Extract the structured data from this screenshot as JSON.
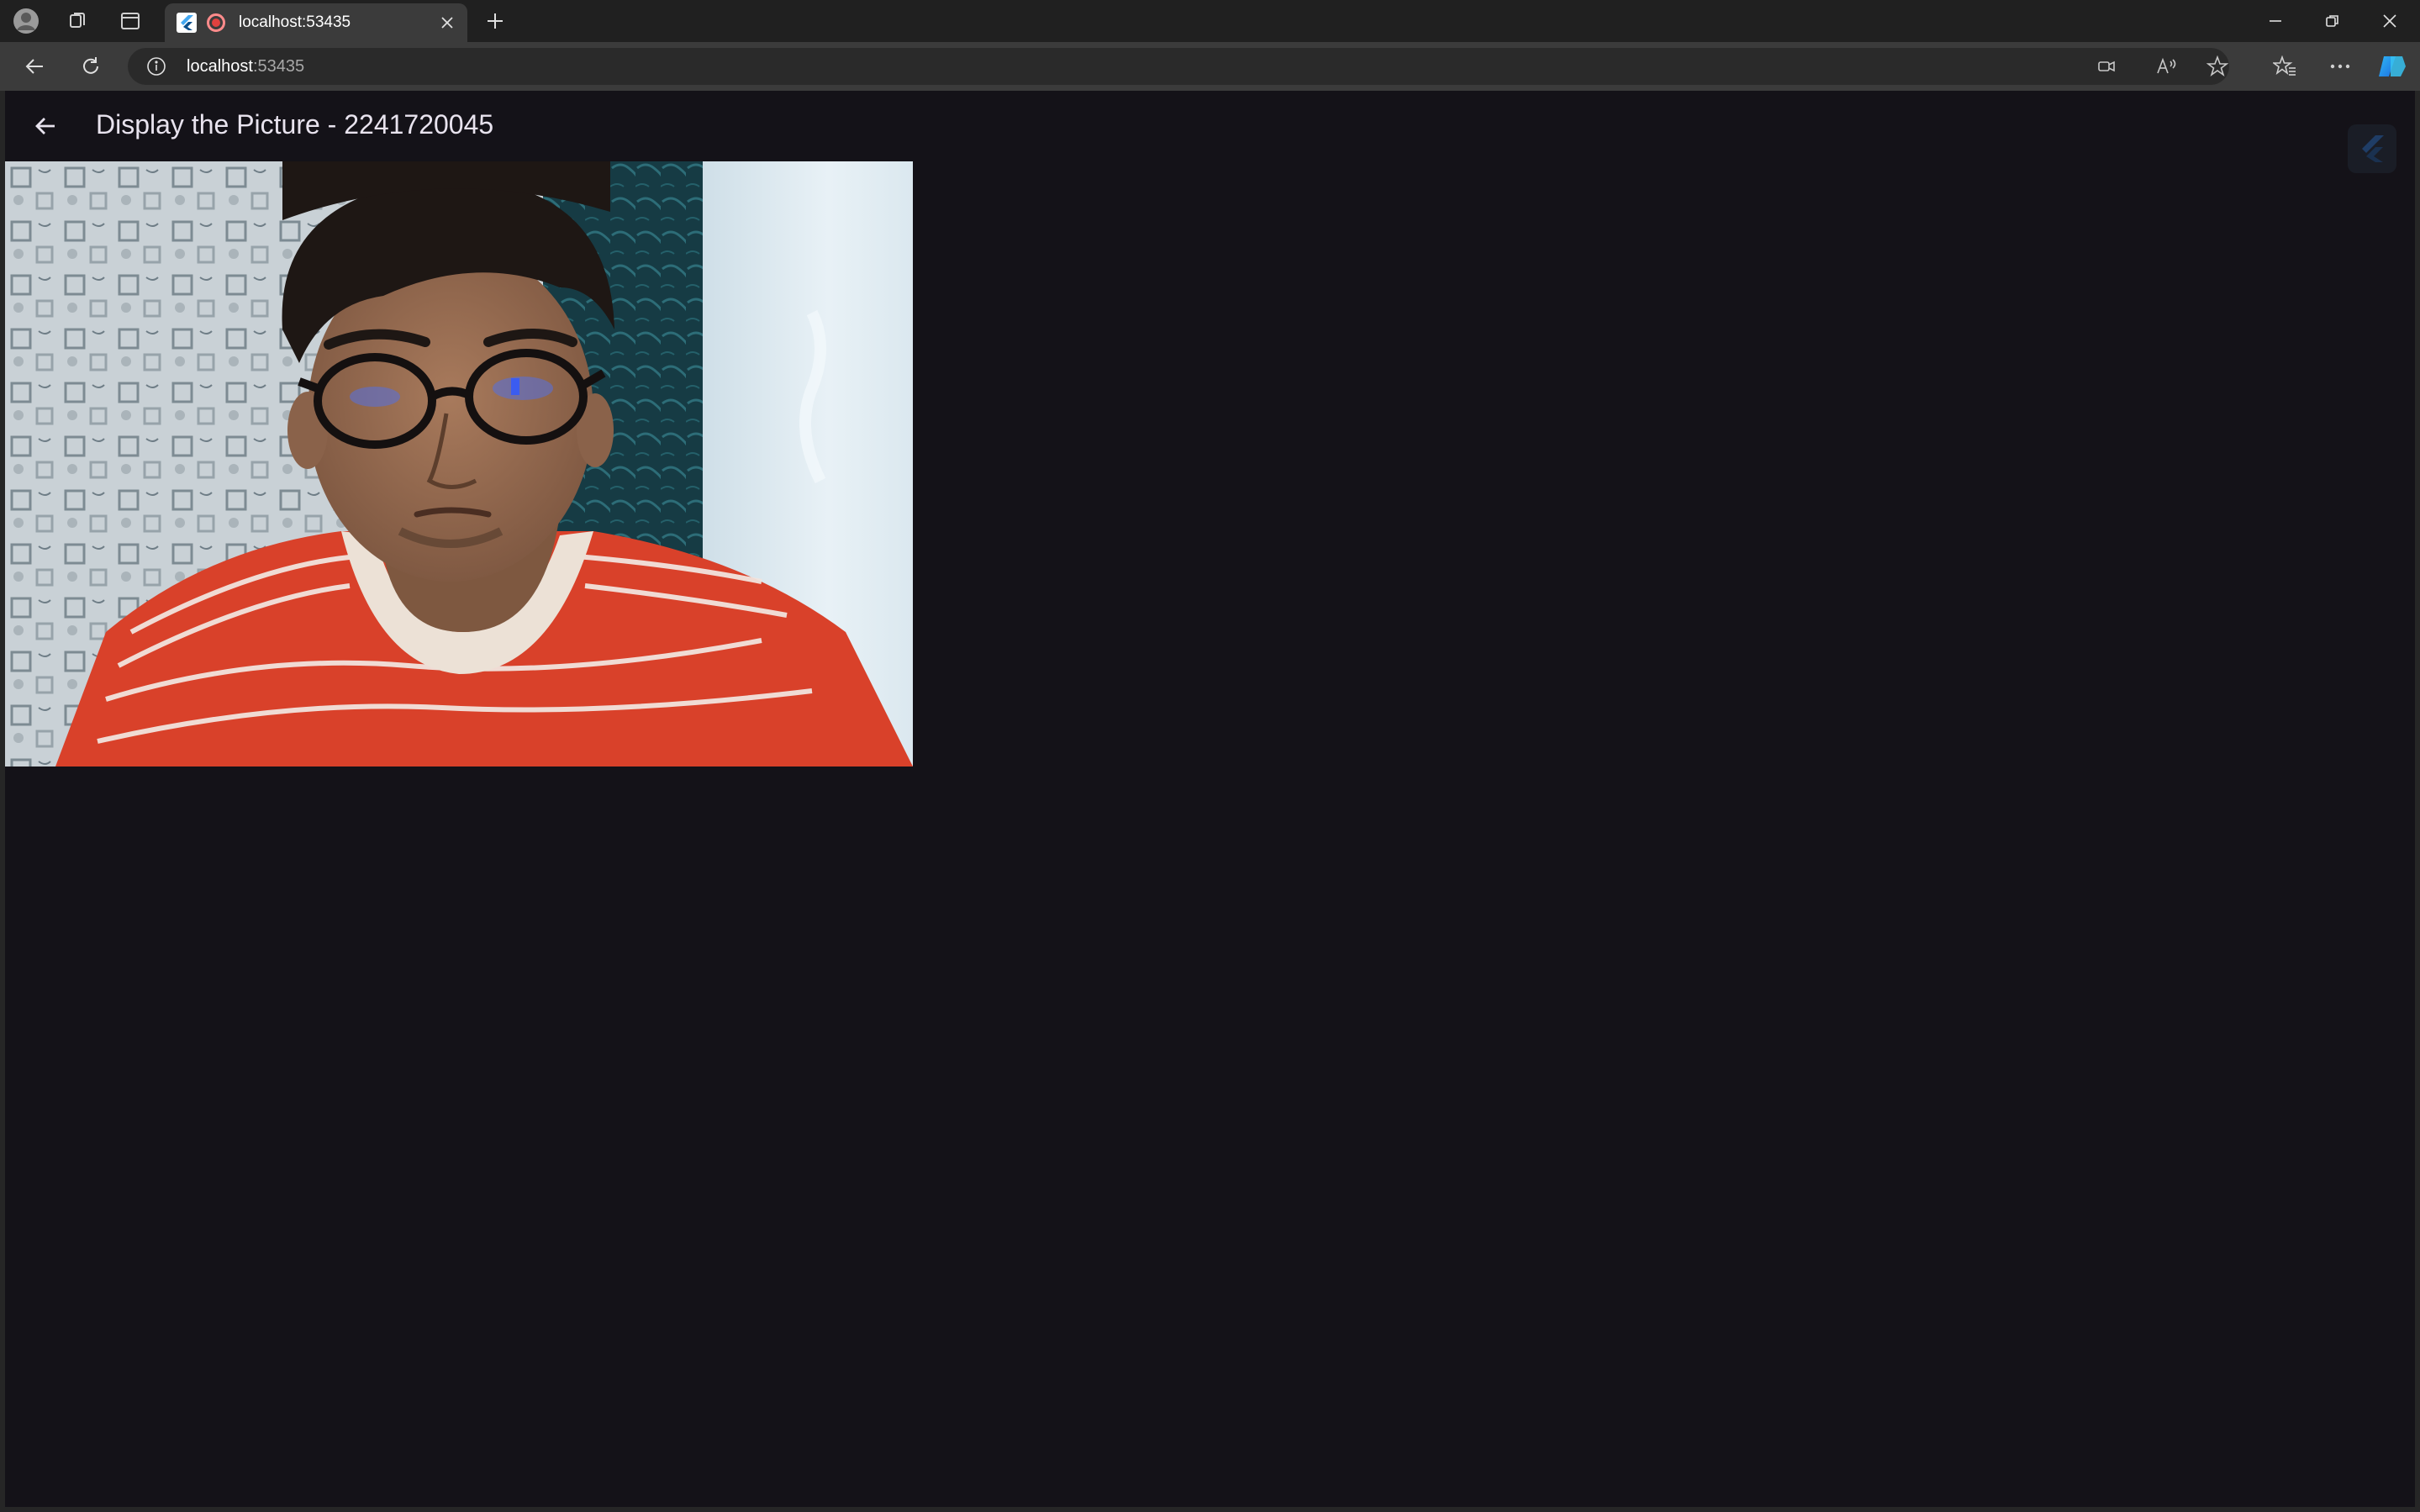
{
  "browser": {
    "tab": {
      "title": "localhost:53435"
    },
    "address": {
      "host": "localhost",
      "port": ":53435"
    },
    "icons": {
      "profile": "profile-icon",
      "workspaces": "workspaces-icon",
      "tab_actions": "tab-actions-icon",
      "close_tab": "close-icon",
      "new_tab": "plus-icon",
      "minimize": "minimize-icon",
      "restore": "restore-icon",
      "close_window": "close-icon",
      "back": "back-arrow-icon",
      "refresh": "refresh-icon",
      "site_info": "info-icon",
      "camera": "camera-icon",
      "read_aloud": "read-aloud-icon",
      "favorite": "star-icon",
      "favorites": "favorites-icon",
      "more": "more-icon",
      "copilot": "copilot-icon"
    }
  },
  "app": {
    "title": "Display the Picture - 2241720045",
    "back_icon": "back-arrow-icon",
    "photo": {
      "subject": "captured-photo"
    }
  },
  "colors": {
    "page_background": "#141218",
    "tab_strip": "#202020",
    "toolbar": "#3b3b3b",
    "title_text": "#e8e3ee",
    "recording": "#e0413f"
  }
}
